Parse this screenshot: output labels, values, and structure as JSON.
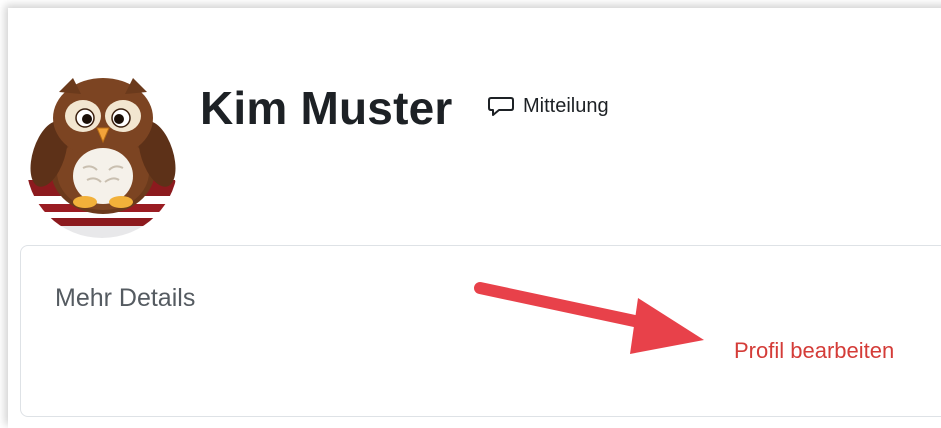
{
  "profile": {
    "name": "Kim Muster",
    "message_label": "Mitteilung",
    "message_icon": "speech-bubble-icon",
    "avatar_icon": "owl-avatar"
  },
  "details": {
    "title": "Mehr Details",
    "edit_label": "Profil bearbeiten"
  },
  "colors": {
    "link": "#d43c38",
    "annotation_arrow": "#e8414a",
    "text": "#1d2125",
    "muted": "#555b61"
  }
}
